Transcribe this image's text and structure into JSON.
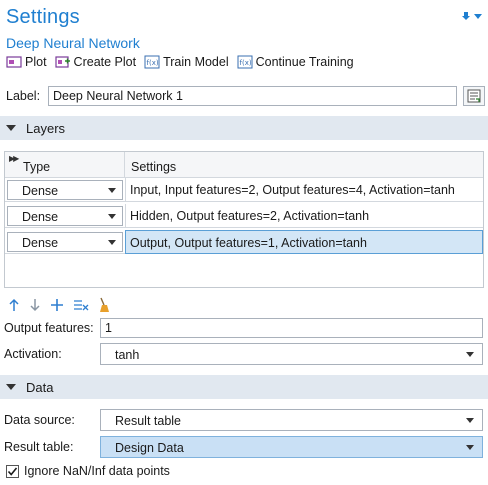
{
  "header": {
    "title": "Settings",
    "subtitle": "Deep Neural Network"
  },
  "toolbar": {
    "plot": "Plot",
    "create_plot": "Create Plot",
    "train_model": "Train Model",
    "continue_training": "Continue Training"
  },
  "label_field": {
    "label": "Label:",
    "value": "Deep Neural Network 1"
  },
  "layers_section": {
    "title": "Layers",
    "columns": [
      "Type",
      "Settings"
    ],
    "rows": [
      {
        "type": "Dense",
        "settings": "Input, Input features=2, Output features=4, Activation=tanh"
      },
      {
        "type": "Dense",
        "settings": "Hidden, Output features=2, Activation=tanh"
      },
      {
        "type": "Dense",
        "settings": "Output, Output features=1, Activation=tanh"
      }
    ]
  },
  "layer_settings": {
    "output_features_label": "Output features:",
    "output_features_value": "1",
    "activation_label": "Activation:",
    "activation_value": "tanh"
  },
  "data_section": {
    "title": "Data",
    "data_source_label": "Data source:",
    "data_source_value": "Result table",
    "result_table_label": "Result table:",
    "result_table_value": "Design Data",
    "ignore_nan_label": "Ignore NaN/Inf data points",
    "ignore_nan_checked": true
  },
  "colors": {
    "accent": "#1f7fd0",
    "section_bg": "#e1e8f0",
    "selection_bg": "#d3e6f6",
    "highlight_select": "#c9e0f5"
  }
}
